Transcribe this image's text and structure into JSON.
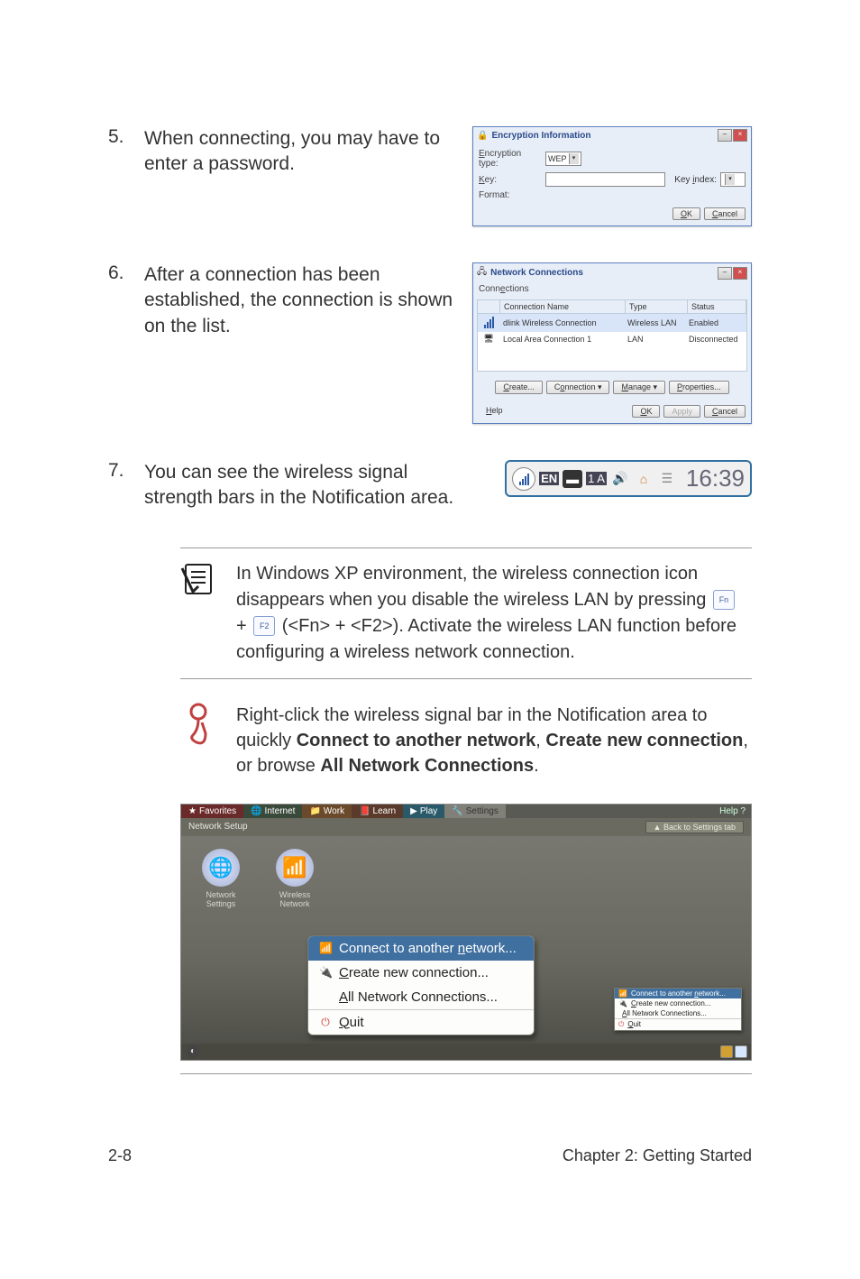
{
  "steps": {
    "s5": {
      "num": "5.",
      "text": "When connecting, you may have to enter a password."
    },
    "s6": {
      "num": "6.",
      "text": "After a connection has been established, the connection is shown on the list."
    },
    "s7": {
      "num": "7.",
      "text": "You can see the wireless signal strength bars in the Notification area."
    }
  },
  "encryption_dialog": {
    "title": "Encryption Information",
    "type_label": "Encryption type:",
    "type_value": "WEP",
    "key_label": "Key:",
    "key_value": "",
    "format_label": "Format:",
    "keyindex_label": "Key index:",
    "ok": "OK",
    "cancel": "Cancel"
  },
  "network_dialog": {
    "title": "Network Connections",
    "menu": "Connections",
    "cols": {
      "name": "Connection Name",
      "type": "Type",
      "status": "Status"
    },
    "rows": [
      {
        "name": "dlink Wireless Connection",
        "type": "Wireless LAN",
        "status": "Enabled"
      },
      {
        "name": "Local Area Connection 1",
        "type": "LAN",
        "status": "Disconnected"
      }
    ],
    "btns": {
      "create": "Create...",
      "connection": "Connection ▾",
      "manage": "Manage ▾",
      "properties": "Properties..."
    },
    "help": "Help",
    "ok": "OK",
    "apply": "Apply",
    "cancel": "Cancel"
  },
  "tray": {
    "en": "EN",
    "one_a": "1 A",
    "time": "16:39"
  },
  "note": {
    "line1": "In Windows XP environment, the wireless connection icon disappears when you disable the wireless LAN by pressing ",
    "fn": "Fn",
    "f2": "F2",
    "line2_mid": " (<Fn> + <F2>). Activate the wireless LAN function before configuring a wireless network connection.",
    "plus": " + "
  },
  "tip": {
    "pre": "Right-click the wireless signal bar in the Notification area to quickly ",
    "b1": "Connect to another network",
    "mid1": ", ",
    "b2": "Create new connection",
    "mid2": ", or browse ",
    "b3": "All Network Connections",
    "post": "."
  },
  "launcher": {
    "tabs": {
      "fav": "Favorites",
      "int": "Internet",
      "wrk": "Work",
      "lrn": "Learn",
      "ply": "Play",
      "set": "Settings"
    },
    "help": "Help ?",
    "sub_title": "Network Setup",
    "back": "Back to Settings tab",
    "desk": {
      "net": "Network Settings",
      "wifi": "Wireless Network"
    },
    "ctx": {
      "connect": "Connect to another network...",
      "create": "Create new connection...",
      "all": "All Network Connections...",
      "quit": "Quit"
    },
    "mini": {
      "connect": "Connect to another network...",
      "create": "Create new connection...",
      "all": "All Network Connections...",
      "quit": "Quit"
    }
  },
  "footer": {
    "left": "2-8",
    "right": "Chapter 2: Getting Started"
  }
}
